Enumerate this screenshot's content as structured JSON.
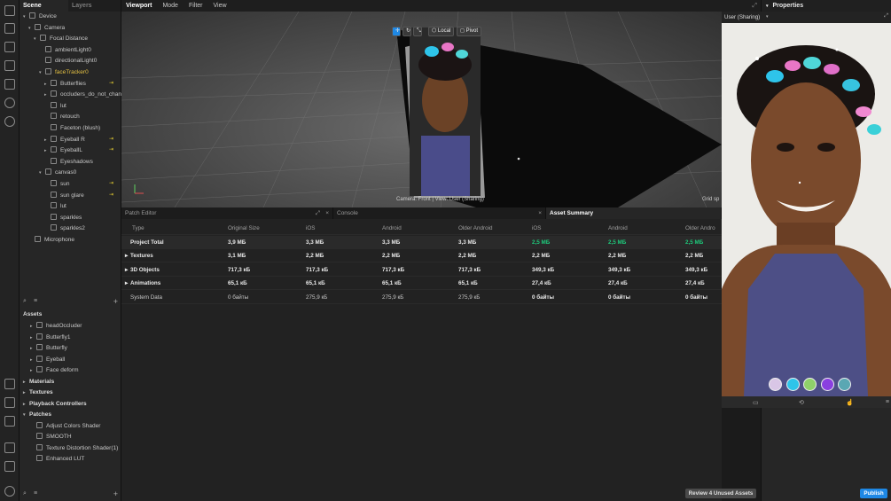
{
  "scene_panel": {
    "tabs": [
      "Scene",
      "Layers"
    ],
    "tree": [
      {
        "label": "Device",
        "indent": 0,
        "caret": "▾"
      },
      {
        "label": "Camera",
        "indent": 1,
        "caret": "▾"
      },
      {
        "label": "Focal Distance",
        "indent": 2,
        "caret": "▾"
      },
      {
        "label": "ambientLight0",
        "indent": 3,
        "caret": ""
      },
      {
        "label": "directionalLight0",
        "indent": 3,
        "caret": ""
      },
      {
        "label": "faceTracker0",
        "indent": 3,
        "caret": "▾",
        "selected": true
      },
      {
        "label": "Butterflies",
        "indent": 4,
        "caret": "▸",
        "pin": true
      },
      {
        "label": "occluders_do_not_chan...",
        "indent": 4,
        "caret": "▸"
      },
      {
        "label": "lut",
        "indent": 4,
        "caret": ""
      },
      {
        "label": "retouch",
        "indent": 4,
        "caret": ""
      },
      {
        "label": "Faceton (blush)",
        "indent": 4,
        "caret": ""
      },
      {
        "label": "Eyeball R",
        "indent": 4,
        "caret": "▸",
        "pin": true
      },
      {
        "label": "EyeballL",
        "indent": 4,
        "caret": "▸",
        "pin": true
      },
      {
        "label": "Eyeshadows",
        "indent": 4,
        "caret": ""
      },
      {
        "label": "canvas0",
        "indent": 3,
        "caret": "▾"
      },
      {
        "label": "sun",
        "indent": 4,
        "caret": "",
        "pin": true
      },
      {
        "label": "sun glare",
        "indent": 4,
        "caret": "",
        "pin": true
      },
      {
        "label": "lut",
        "indent": 4,
        "caret": ""
      },
      {
        "label": "sparkles",
        "indent": 4,
        "caret": ""
      },
      {
        "label": "sparkles2",
        "indent": 4,
        "caret": ""
      },
      {
        "label": "Microphone",
        "indent": 1,
        "caret": ""
      }
    ],
    "assets_title": "Assets",
    "assets": [
      {
        "label": "headOccluder",
        "caret": "▸",
        "indent": 1
      },
      {
        "label": "Butterfly1",
        "caret": "▸",
        "indent": 1
      },
      {
        "label": "Butterfly",
        "caret": "▸",
        "indent": 1
      },
      {
        "label": "Eyeball",
        "caret": "▸",
        "indent": 1
      },
      {
        "label": "Face deform",
        "caret": "▸",
        "indent": 1
      },
      {
        "label": "Materials",
        "caret": "▸",
        "indent": 0,
        "bold": true
      },
      {
        "label": "Textures",
        "caret": "▸",
        "indent": 0,
        "bold": true
      },
      {
        "label": "Playback Controllers",
        "caret": "▸",
        "indent": 0,
        "bold": true
      },
      {
        "label": "Patches",
        "caret": "▾",
        "indent": 0,
        "bold": true
      },
      {
        "label": "Adjust Colors Shader",
        "caret": "",
        "indent": 1
      },
      {
        "label": "SMOOTH",
        "caret": "",
        "indent": 1
      },
      {
        "label": "Texture Distortion Shader(1)",
        "caret": "",
        "indent": 1
      },
      {
        "label": "Enhanced LUT",
        "caret": "",
        "indent": 1
      }
    ],
    "add_symbol": "+"
  },
  "menubar": {
    "items": [
      "Viewport",
      "Mode",
      "Filter",
      "View"
    ]
  },
  "viewport": {
    "tools": [
      "Local",
      "Pivot"
    ],
    "camera_label": "Camera: Front | View: User (Sharing)",
    "grid_label": "Grid sp"
  },
  "bottom_tabs": {
    "patch_editor": "Patch Editor",
    "console": "Console",
    "asset_summary": "Asset Summary",
    "close_symbol": "×"
  },
  "asset_summary": {
    "headers": [
      "Type",
      "Original Size",
      "iOS",
      "Android",
      "Older Android",
      "iOS",
      "Android",
      "Older Andro"
    ],
    "rows": [
      {
        "type": "Project Total",
        "caret": "",
        "orig": "3,9 МБ",
        "ios": "3,3 МБ",
        "android": "3,3 МБ",
        "older": "3,3 МБ",
        "c_ios": "2,5 МБ",
        "c_android": "2,5 МБ",
        "c_older": "2,5 МБ",
        "green": true
      },
      {
        "type": "Textures",
        "caret": "▸",
        "orig": "3,1 МБ",
        "ios": "2,2 МБ",
        "android": "2,2 МБ",
        "older": "2,2 МБ",
        "c_ios": "2,2 МБ",
        "c_android": "2,2 МБ",
        "c_older": "2,2 МБ"
      },
      {
        "type": "3D Objects",
        "caret": "▸",
        "orig": "717,3 кБ",
        "ios": "717,3 кБ",
        "android": "717,3 кБ",
        "older": "717,3 кБ",
        "c_ios": "349,3 кБ",
        "c_android": "349,3 кБ",
        "c_older": "349,3 кБ"
      },
      {
        "type": "Animations",
        "caret": "▸",
        "orig": "65,1 кБ",
        "ios": "65,1 кБ",
        "android": "65,1 кБ",
        "older": "65,1 кБ",
        "c_ios": "27,4 кБ",
        "c_android": "27,4 кБ",
        "c_older": "27,4 кБ"
      },
      {
        "type": "System Data",
        "caret": "",
        "orig": "0 байты",
        "ios": "275,9 кБ",
        "android": "275,9 кБ",
        "older": "275,9 кБ",
        "c_ios": "0 байты",
        "c_android": "0 байты",
        "c_older": "0 байты",
        "plain": true
      }
    ],
    "review_button": "Review 4 Unused Assets"
  },
  "preview": {
    "device_label": "User (Sharing)",
    "swatch_colors": [
      "#d9c6e6",
      "#2ec4ea",
      "#8fd06a",
      "#8a3fe0",
      "#5aa7b3"
    ]
  },
  "properties": {
    "title": "Properties",
    "publish": "Publish"
  }
}
